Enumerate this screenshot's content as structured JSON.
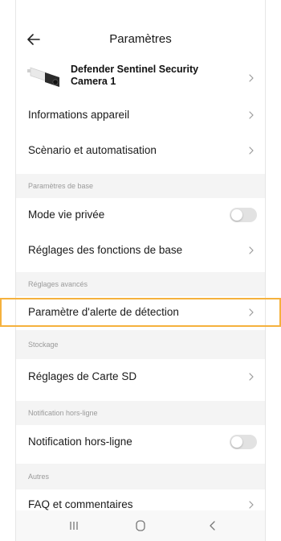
{
  "header": {
    "title": "Paramètres"
  },
  "device": {
    "name": "Defender Sentinel Security Camera 1"
  },
  "rows": {
    "device_info": "Informations appareil",
    "scenario": "Scènario et automatisation",
    "privacy_mode": "Mode vie privée",
    "basic_settings": "Réglages des fonctions de base",
    "detection_alert": "Paramètre d'alerte de détection",
    "sd_card": "Réglages de Carte SD",
    "offline_notification": "Notification hors-ligne",
    "faq": "FAQ et commentaires"
  },
  "sections": {
    "basic": "Paramètres de base",
    "advanced": "Réglages avancés",
    "storage": "Stockage",
    "offline": "Notification hors-ligne",
    "other": "Autres"
  },
  "toggles": {
    "privacy_mode": false,
    "offline_notification": false
  },
  "colors": {
    "highlight": "#f5b13d",
    "section_bg": "#f4f4f4",
    "toggle_off": "#e2e2e2"
  },
  "icons": [
    "back-arrow-icon",
    "camera-thumbnail",
    "chevron-right-icon",
    "recents-icon",
    "home-icon",
    "back-nav-icon"
  ]
}
